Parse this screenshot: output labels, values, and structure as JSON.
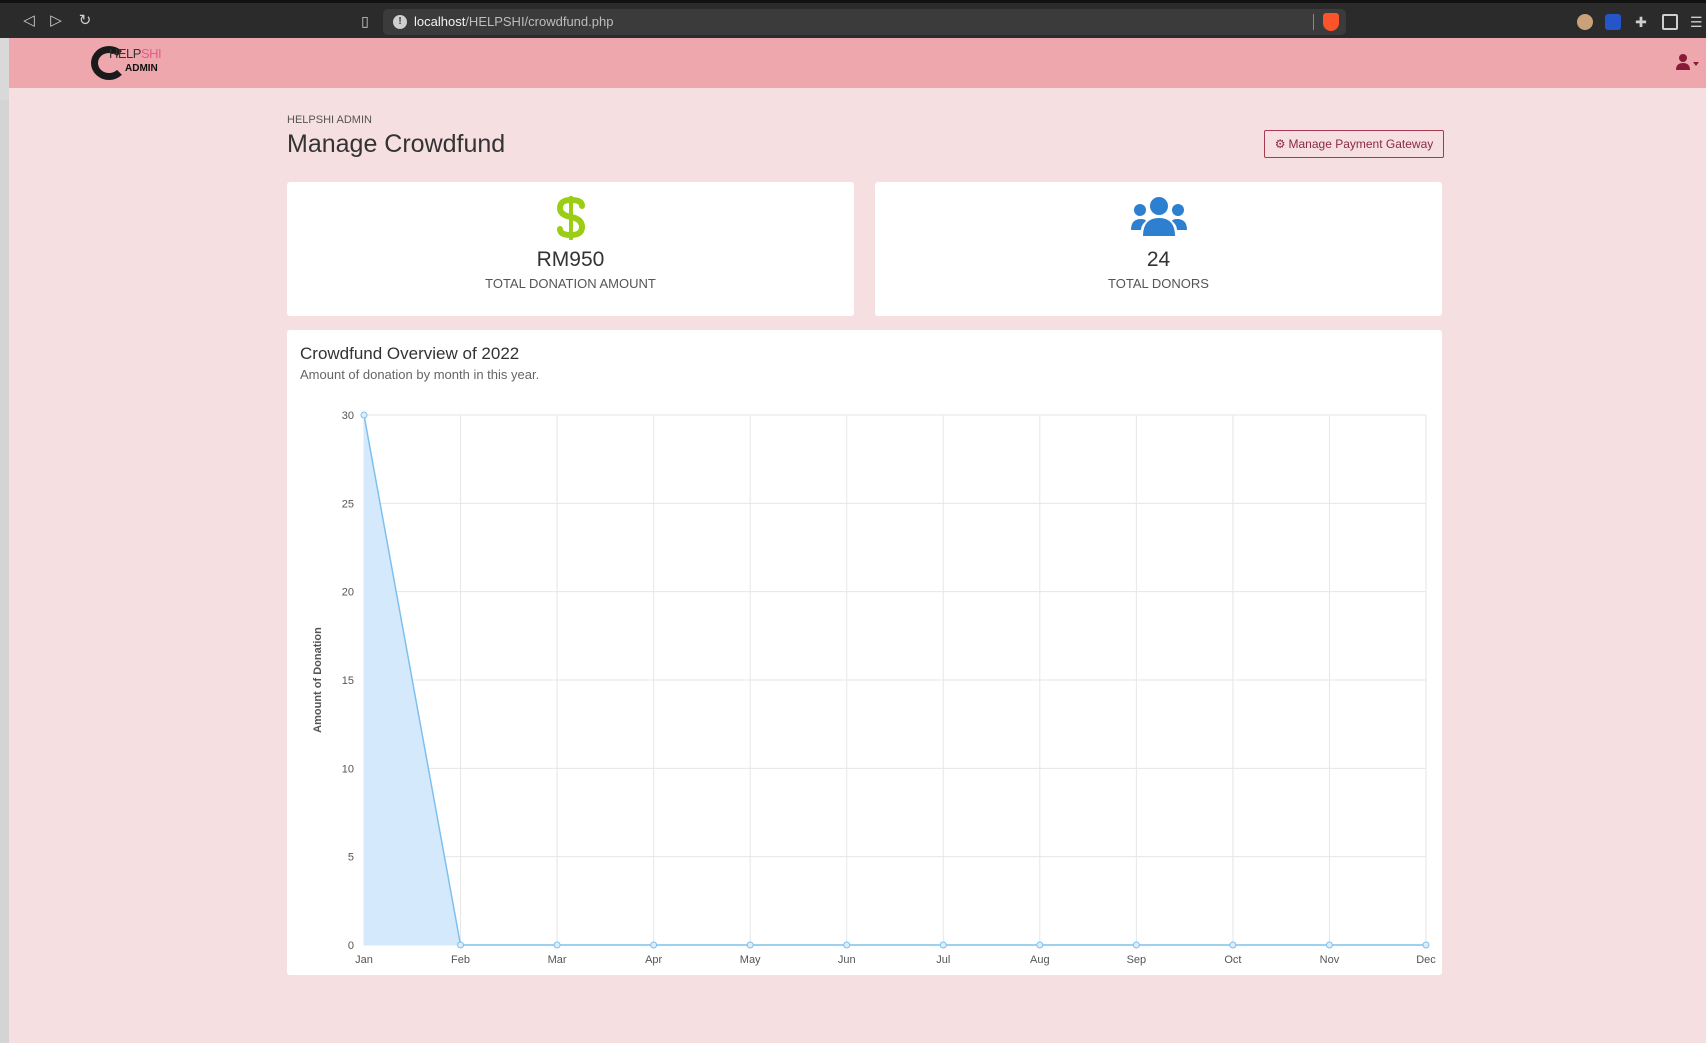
{
  "browser": {
    "url_host": "localhost",
    "url_path": "/HELPSHI/crowdfund.php"
  },
  "header": {
    "logo_text_top_a": "HELP",
    "logo_text_top_b": "SHI",
    "logo_text_bottom": "ADMIN"
  },
  "page": {
    "breadcrumb": "HELPSHI ADMIN",
    "title": "Manage Crowdfund",
    "gateway_button": "Manage Payment Gateway"
  },
  "stats": {
    "donation": {
      "value": "RM950",
      "label": "TOTAL DONATION AMOUNT",
      "icon": "dollar-icon",
      "color": "#9acd14"
    },
    "donors": {
      "value": "24",
      "label": "TOTAL DONORS",
      "icon": "users-icon",
      "color": "#2d7fcf"
    }
  },
  "chart": {
    "title": "Crowdfund Overview of 2022",
    "subtitle": "Amount of donation by month in this year."
  },
  "chart_data": {
    "type": "area",
    "categories": [
      "Jan",
      "Feb",
      "Mar",
      "Apr",
      "May",
      "Jun",
      "Jul",
      "Aug",
      "Sep",
      "Oct",
      "Nov",
      "Dec"
    ],
    "values": [
      30,
      0,
      0,
      0,
      0,
      0,
      0,
      0,
      0,
      0,
      0,
      0
    ],
    "ylabel": "Amount of Donation",
    "ylim": [
      0,
      30
    ],
    "yticks": [
      0,
      5,
      10,
      15,
      20,
      25,
      30
    ],
    "grid": true,
    "line_color": "#7ec0ee",
    "fill_color": "#d4e9fb"
  }
}
